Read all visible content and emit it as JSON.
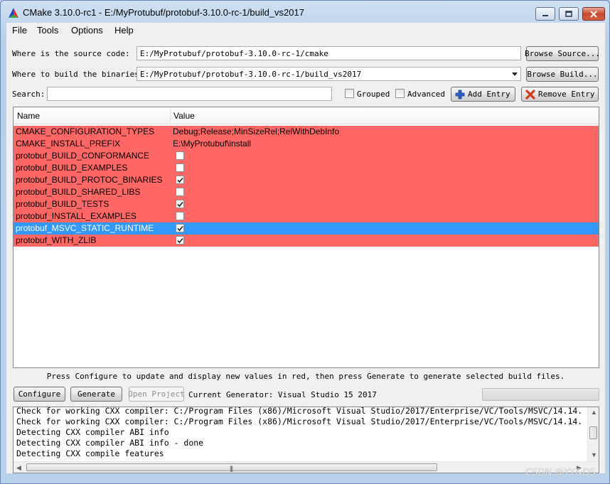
{
  "window": {
    "title": "CMake 3.10.0-rc1 - E:/MyProtubuf/protobuf-3.10.0-rc-1/build_vs2017"
  },
  "menu": {
    "items": [
      "File",
      "Tools",
      "Options",
      "Help"
    ]
  },
  "source": {
    "label": "Where is the source code:",
    "value": "E:/MyProtubuf/protobuf-3.10.0-rc-1/cmake",
    "browse_label": "Browse Source..."
  },
  "build": {
    "label": "Where to build the binaries:",
    "value": "E:/MyProtubuf/protobuf-3.10.0-rc-1/build_vs2017",
    "browse_label": "Browse Build..."
  },
  "search": {
    "label": "Search:",
    "value": "",
    "grouped_label": "Grouped",
    "grouped_checked": false,
    "advanced_label": "Advanced",
    "advanced_checked": false,
    "add_entry_label": "Add Entry",
    "remove_entry_label": "Remove Entry"
  },
  "table": {
    "headers": {
      "name": "Name",
      "value": "Value"
    },
    "rows": [
      {
        "name": "CMAKE_CONFIGURATION_TYPES",
        "value": "Debug;Release;MinSizeRel;RelWithDebInfo",
        "type": "text",
        "selected": false
      },
      {
        "name": "CMAKE_INSTALL_PREFIX",
        "value": "E:\\MyProtubuf\\install",
        "type": "text",
        "selected": false
      },
      {
        "name": "protobuf_BUILD_CONFORMANCE",
        "checked": false,
        "type": "bool",
        "selected": false
      },
      {
        "name": "protobuf_BUILD_EXAMPLES",
        "checked": false,
        "type": "bool",
        "selected": false
      },
      {
        "name": "protobuf_BUILD_PROTOC_BINARIES",
        "checked": true,
        "type": "bool",
        "selected": false
      },
      {
        "name": "protobuf_BUILD_SHARED_LIBS",
        "checked": false,
        "type": "bool",
        "selected": false
      },
      {
        "name": "protobuf_BUILD_TESTS",
        "checked": true,
        "type": "bool",
        "selected": false
      },
      {
        "name": "protobuf_INSTALL_EXAMPLES",
        "checked": false,
        "type": "bool",
        "selected": false
      },
      {
        "name": "protobuf_MSVC_STATIC_RUNTIME",
        "checked": true,
        "type": "bool",
        "selected": true
      },
      {
        "name": "protobuf_WITH_ZLIB",
        "checked": true,
        "type": "bool",
        "selected": false
      }
    ]
  },
  "hint": "Press Configure to update and display new values in red, then press Generate to generate selected build files.",
  "actions": {
    "configure_label": "Configure",
    "generate_label": "Generate",
    "open_project_label": "Open Project",
    "generator_text": "Current Generator: Visual Studio 15 2017",
    "progress": 0
  },
  "log": {
    "lines": [
      "Check for working CXX compiler: C:/Program Files (x86)/Microsoft Visual Studio/2017/Enterprise/VC/Tools/MSVC/14.14.",
      "Check for working CXX compiler: C:/Program Files (x86)/Microsoft Visual Studio/2017/Enterprise/VC/Tools/MSVC/14.14.",
      "Detecting CXX compiler ABI info",
      "Detecting CXX compiler ABI info - done",
      "Detecting CXX compile features"
    ]
  },
  "watermark": "CSDN @YY&DS",
  "colors": {
    "row_changed": "#ff6666",
    "row_selected": "#3399ff"
  }
}
